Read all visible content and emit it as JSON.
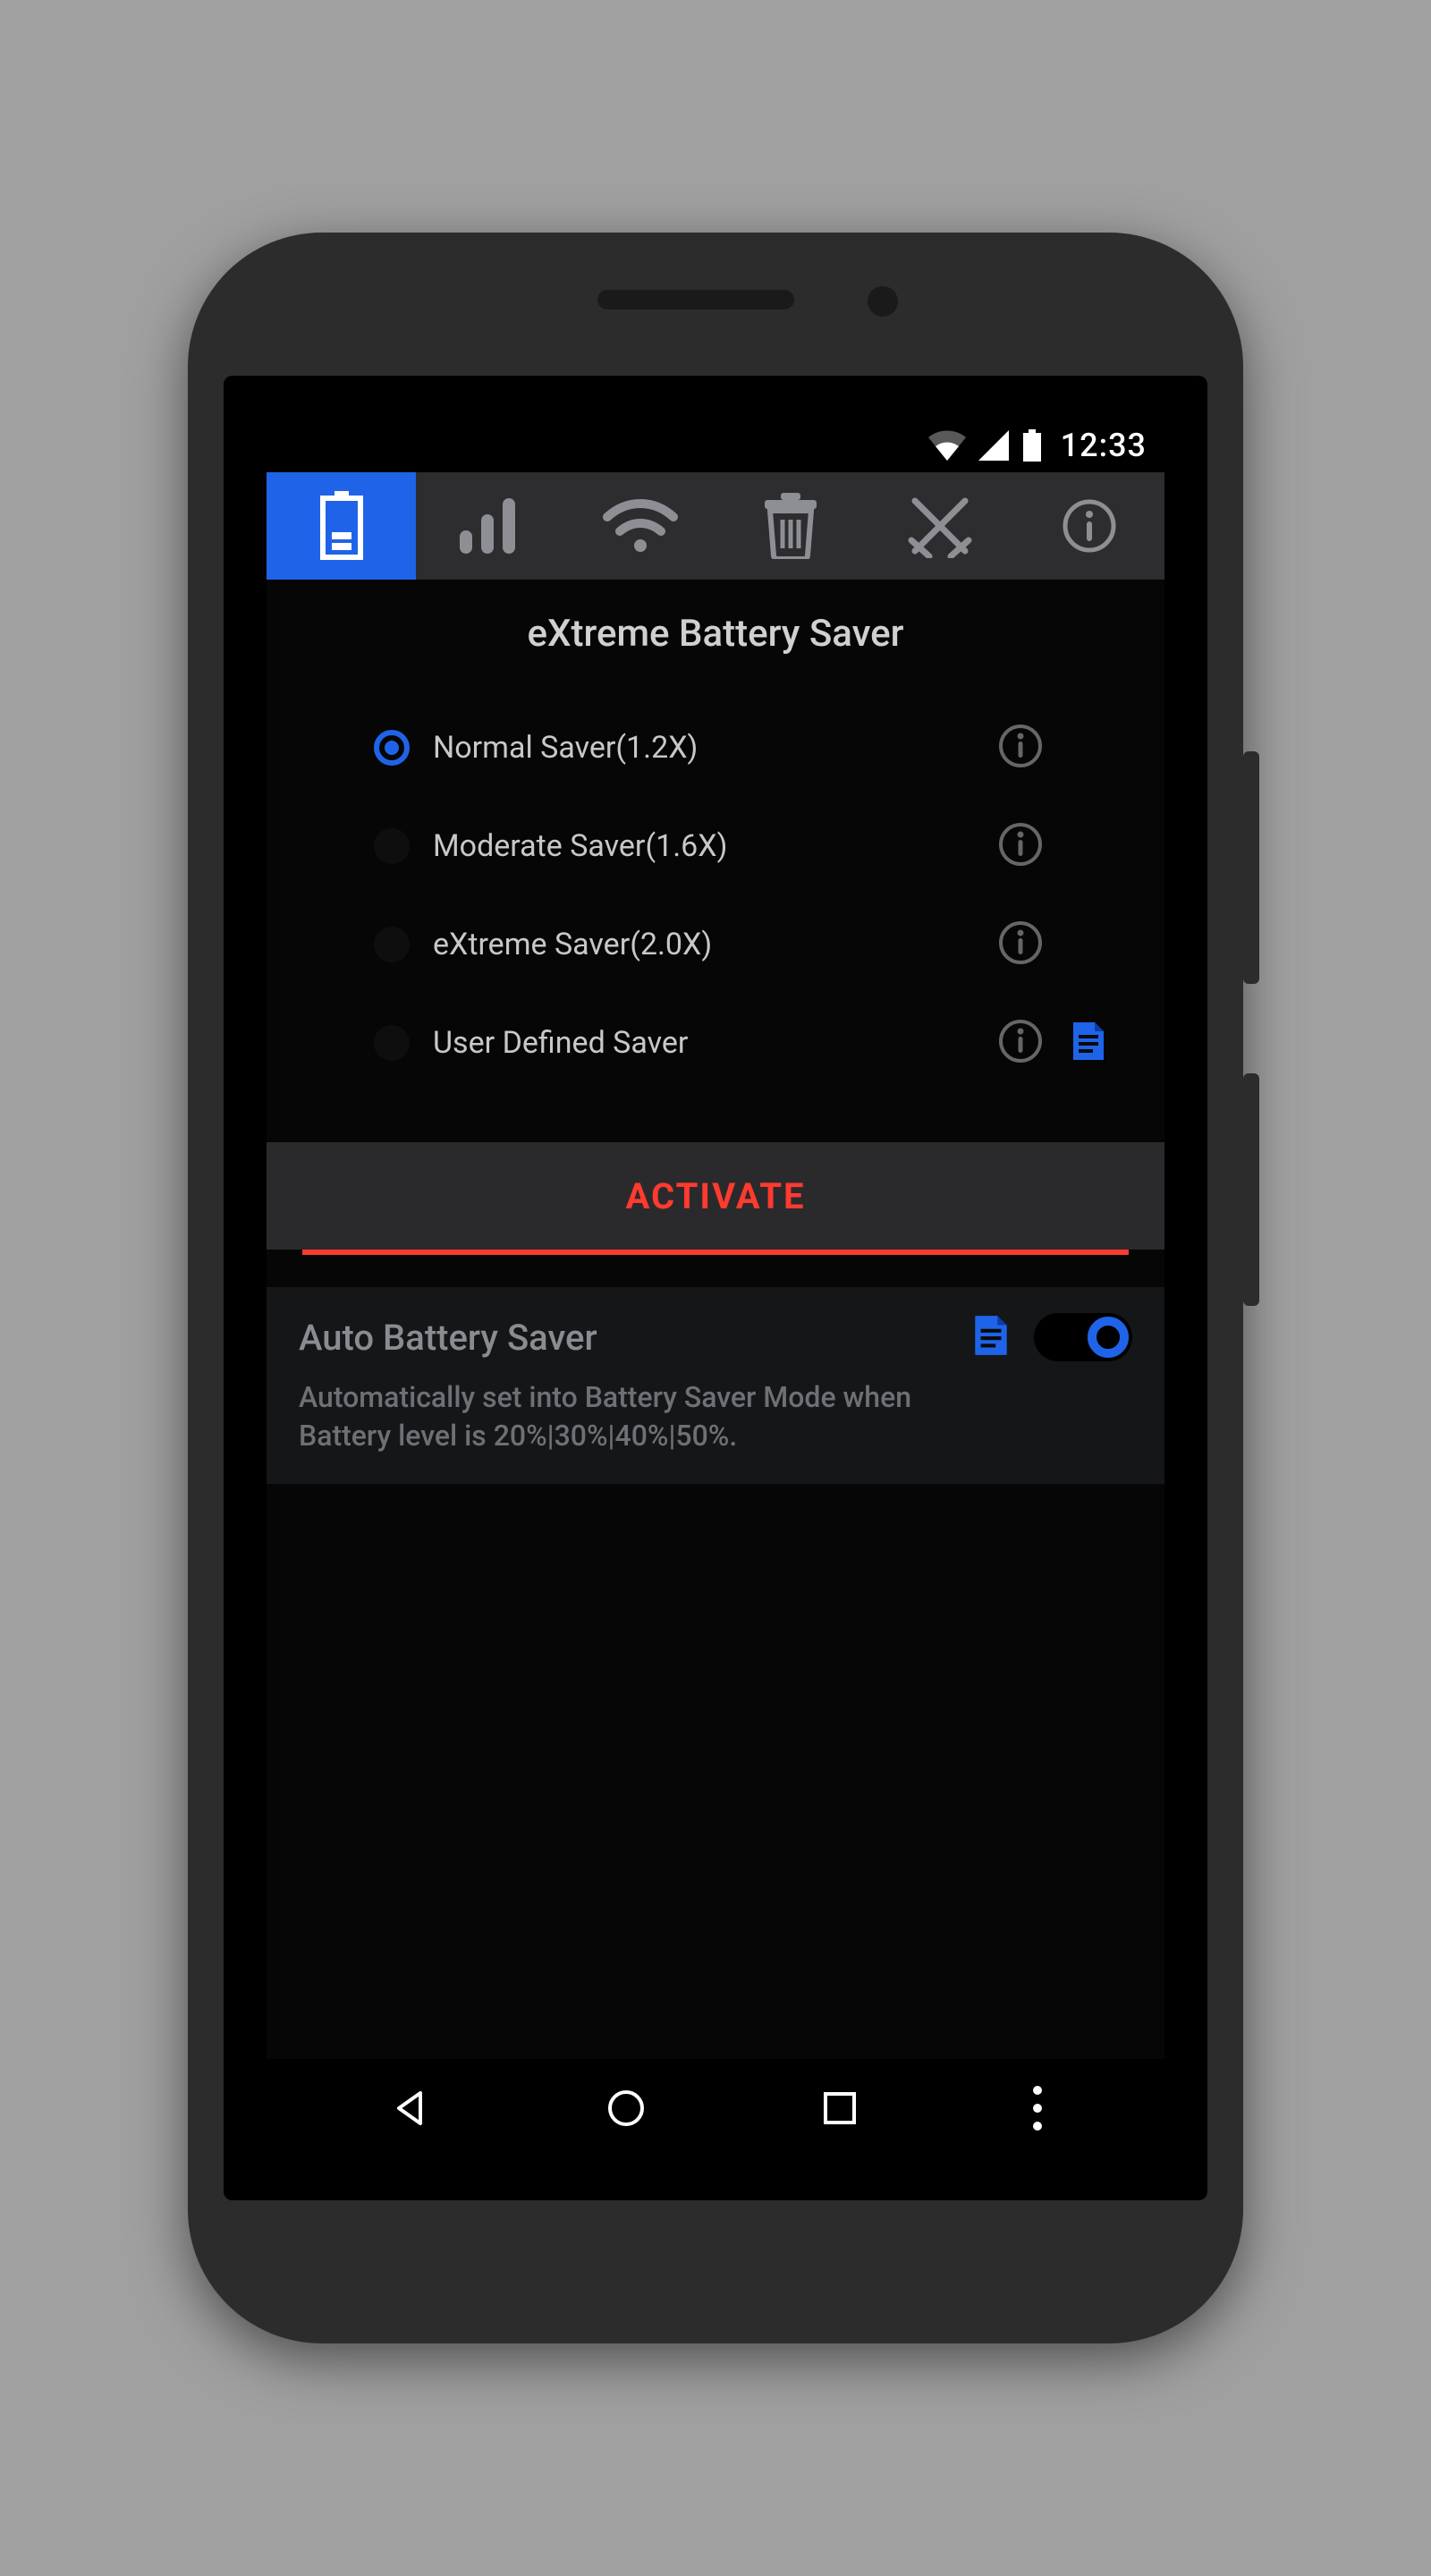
{
  "statusbar": {
    "time": "12:33"
  },
  "heading": "eXtreme Battery Saver",
  "options": {
    "o1": "Normal Saver(1.2X)",
    "o2": "Moderate Saver(1.6X)",
    "o3": "eXtreme Saver(2.0X)",
    "o4": "User Defined Saver"
  },
  "activate_label": "ACTIVATE",
  "auto": {
    "title": "Auto Battery Saver",
    "desc": "Automatically set into Battery Saver Mode when Battery level is 20%|30%|40%|50%."
  },
  "colors": {
    "accent": "#1f64e8",
    "danger": "#ff3a2f"
  }
}
